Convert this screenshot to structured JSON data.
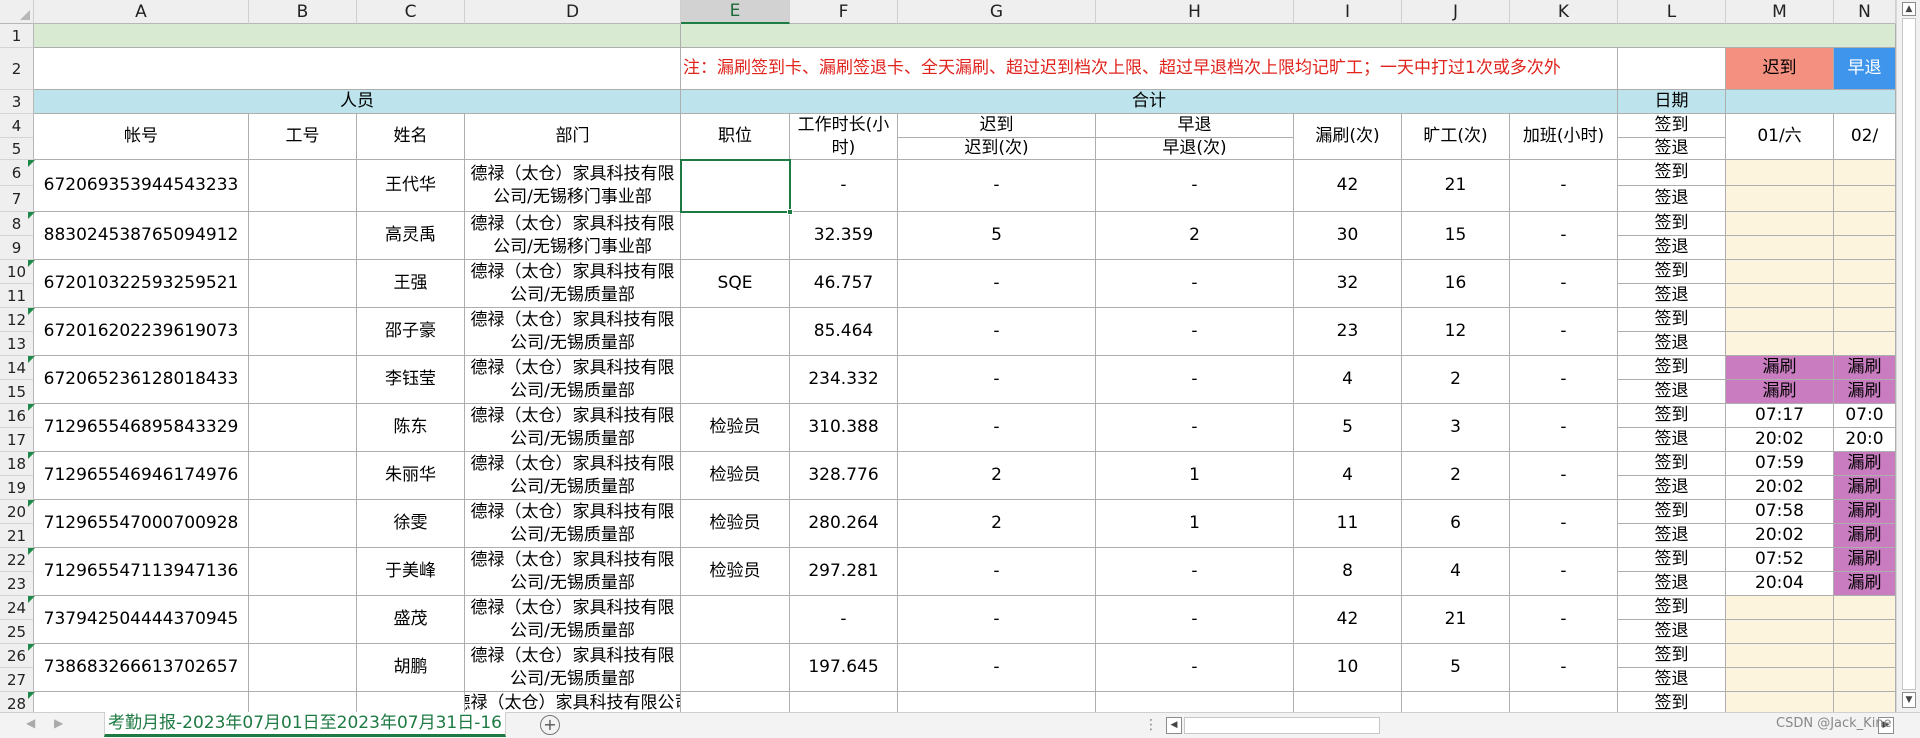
{
  "columns": [
    "A",
    "B",
    "C",
    "D",
    "E",
    "F",
    "G",
    "H",
    "I",
    "J",
    "K",
    "L",
    "M",
    "N"
  ],
  "selected_column": "E",
  "row_numbers": [
    "1",
    "2",
    "3",
    "4",
    "5",
    "6",
    "7",
    "8",
    "9",
    "10",
    "11",
    "12",
    "13",
    "14",
    "15",
    "16",
    "17",
    "18",
    "19",
    "20",
    "21",
    "22",
    "23",
    "24",
    "25",
    "26",
    "27",
    "28"
  ],
  "header": {
    "note": "注：漏刷签到卡、漏刷签退卡、全天漏刷、超过迟到档次上限、超过早退档次上限均记旷工；一天中打过1次或多次外",
    "late_legend": "迟到",
    "early_legend": "早退",
    "personnel": "人员",
    "total": "合计",
    "date": "日期",
    "account": "帐号",
    "emp_no": "工号",
    "name": "姓名",
    "dept": "部门",
    "position": "职位",
    "work_hours": "工作时长(小时)",
    "late": "迟到",
    "late_count": "迟到(次)",
    "early": "早退",
    "early_count": "早退(次)",
    "missed": "漏刷(次)",
    "absent": "旷工(次)",
    "overtime": "加班(小时)",
    "sign_in": "签到",
    "sign_out": "签退",
    "day1": "01/六",
    "day2": "02/"
  },
  "employees": [
    {
      "account": "672069353944543233",
      "name": "王代华",
      "dept": "德禄（太仓）家具科技有限公司/无锡移门事业部",
      "position": "",
      "hours": "-",
      "late": "-",
      "early": "-",
      "missed": "42",
      "absent": "21",
      "overtime": "-",
      "m_in": "",
      "m_out": "",
      "n_in": "",
      "n_out": "",
      "m_type": "cream",
      "n_type": "cream"
    },
    {
      "account": "883024538765094912",
      "name": "高灵禹",
      "dept": "德禄（太仓）家具科技有限公司/无锡移门事业部",
      "position": "",
      "hours": "32.359",
      "late": "5",
      "early": "2",
      "missed": "30",
      "absent": "15",
      "overtime": "-",
      "m_in": "",
      "m_out": "",
      "n_in": "",
      "n_out": "",
      "m_type": "cream",
      "n_type": "cream"
    },
    {
      "account": "672010322593259521",
      "name": "王强",
      "dept": "德禄（太仓）家具科技有限公司/无锡质量部",
      "position": "SQE",
      "hours": "46.757",
      "late": "-",
      "early": "-",
      "missed": "32",
      "absent": "16",
      "overtime": "-",
      "m_in": "",
      "m_out": "",
      "n_in": "",
      "n_out": "",
      "m_type": "cream",
      "n_type": "cream"
    },
    {
      "account": "672016202239619073",
      "name": "邵子豪",
      "dept": "德禄（太仓）家具科技有限公司/无锡质量部",
      "position": "",
      "hours": "85.464",
      "late": "-",
      "early": "-",
      "missed": "23",
      "absent": "12",
      "overtime": "-",
      "m_in": "",
      "m_out": "",
      "n_in": "",
      "n_out": "",
      "m_type": "cream",
      "n_type": "cream"
    },
    {
      "account": "672065236128018433",
      "name": "李钰莹",
      "dept": "德禄（太仓）家具科技有限公司/无锡质量部",
      "position": "",
      "hours": "234.332",
      "late": "-",
      "early": "-",
      "missed": "4",
      "absent": "2",
      "overtime": "-",
      "m_in": "漏刷",
      "m_out": "漏刷",
      "n_in": "漏刷",
      "n_out": "漏刷",
      "m_type": "purple",
      "n_type": "purple"
    },
    {
      "account": "712965546895843329",
      "name": "陈东",
      "dept": "德禄（太仓）家具科技有限公司/无锡质量部",
      "position": "检验员",
      "hours": "310.388",
      "late": "-",
      "early": "-",
      "missed": "5",
      "absent": "3",
      "overtime": "-",
      "m_in": "07:17",
      "m_out": "20:02",
      "n_in": "07:0",
      "n_out": "20:0",
      "m_type": "white",
      "n_type": "white"
    },
    {
      "account": "712965546946174976",
      "name": "朱丽华",
      "dept": "德禄（太仓）家具科技有限公司/无锡质量部",
      "position": "检验员",
      "hours": "328.776",
      "late": "2",
      "early": "1",
      "missed": "4",
      "absent": "2",
      "overtime": "-",
      "m_in": "07:59",
      "m_out": "20:02",
      "n_in": "漏刷",
      "n_out": "漏刷",
      "m_type": "white",
      "n_type": "purple"
    },
    {
      "account": "712965547000700928",
      "name": "徐雯",
      "dept": "德禄（太仓）家具科技有限公司/无锡质量部",
      "position": "检验员",
      "hours": "280.264",
      "late": "2",
      "early": "1",
      "missed": "11",
      "absent": "6",
      "overtime": "-",
      "m_in": "07:58",
      "m_out": "20:02",
      "n_in": "漏刷",
      "n_out": "漏刷",
      "m_type": "white",
      "n_type": "purple"
    },
    {
      "account": "712965547113947136",
      "name": "于美峰",
      "dept": "德禄（太仓）家具科技有限公司/无锡质量部",
      "position": "检验员",
      "hours": "297.281",
      "late": "-",
      "early": "-",
      "missed": "8",
      "absent": "4",
      "overtime": "-",
      "m_in": "07:52",
      "m_out": "20:04",
      "n_in": "漏刷",
      "n_out": "漏刷",
      "m_type": "white",
      "n_type": "purple"
    },
    {
      "account": "737942504444370945",
      "name": "盛茂",
      "dept": "德禄（太仓）家具科技有限公司/无锡质量部",
      "position": "",
      "hours": "-",
      "late": "-",
      "early": "-",
      "missed": "42",
      "absent": "21",
      "overtime": "-",
      "m_in": "",
      "m_out": "",
      "n_in": "",
      "n_out": "",
      "m_type": "cream",
      "n_type": "cream"
    },
    {
      "account": "738683266613702657",
      "name": "胡鹏",
      "dept": "德禄（太仓）家具科技有限公司/无锡质量部",
      "position": "",
      "hours": "197.645",
      "late": "-",
      "early": "-",
      "missed": "10",
      "absent": "5",
      "overtime": "-",
      "m_in": "",
      "m_out": "",
      "n_in": "",
      "n_out": "",
      "m_type": "cream",
      "n_type": "cream"
    }
  ],
  "partial_row": {
    "dept": "德禄（太仓）家具科技有限公司",
    "sign": "签到"
  },
  "sheet_tab": "考勤月报-2023年07月01日至2023年07月31日-16",
  "watermark": "CSDN @Jack_Kine",
  "add_sheet": "+"
}
